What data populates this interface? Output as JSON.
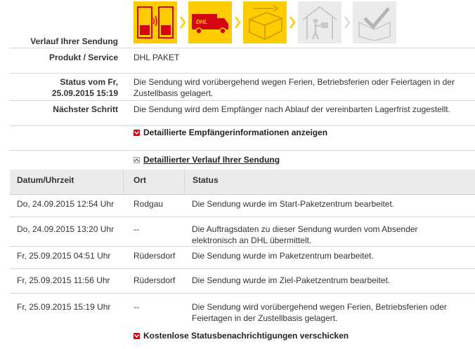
{
  "progress": {
    "label": "Verlauf Ihrer Sendung",
    "steps": [
      {
        "icon": "drop-off-icon",
        "state": "done"
      },
      {
        "icon": "truck-icon",
        "state": "done"
      },
      {
        "icon": "package-icon",
        "state": "done"
      },
      {
        "icon": "delivery-person-icon",
        "state": "pending"
      },
      {
        "icon": "delivered-check-icon",
        "state": "pending"
      }
    ],
    "colors": {
      "done": "#ffcc00",
      "pending": "#ebebeb",
      "dhl_red": "#d40511"
    }
  },
  "details": {
    "product_label": "Produkt / Service",
    "product_value": "DHL PAKET",
    "status_label_line1": "Status vom Fr,",
    "status_label_line2": "25.09.2015 15:19",
    "status_value": "Die Sendung wird vorübergehend wegen Ferien, Betriebsferien oder Feiertagen in der Zustellbasis gelagert.",
    "next_label": "Nächster Schritt",
    "next_value": "Die Sendung wird dem Empfänger nach Ablauf der vereinbarten Lagerfrist zugestellt."
  },
  "toggles": {
    "recipient_info": "Detaillierte Empfängerinformationen anzeigen",
    "history": "Detaillierter Verlauf Ihrer Sendung",
    "notifications": "Kostenlose Statusbenachrichtigungen verschicken"
  },
  "history": {
    "columns": [
      "Datum/Uhrzeit",
      "Ort",
      "Status"
    ],
    "rows": [
      {
        "date": "Do, 24.09.2015 12:54 Uhr",
        "place": "Rodgau",
        "status": "Die Sendung wurde im Start-Paketzentrum bearbeitet."
      },
      {
        "date": "Do, 24.09.2015 13:20 Uhr",
        "place": "--",
        "status": "Die Auftragsdaten zu dieser Sendung wurden vom Absender elektronisch an DHL übermittelt."
      },
      {
        "date": "Fr, 25.09.2015 04:51 Uhr",
        "place": "Rüdersdorf",
        "status": "Die Sendung wurde im Paketzentrum bearbeitet."
      },
      {
        "date": "Fr, 25.09.2015 11:56 Uhr",
        "place": "Rüdersdorf",
        "status": "Die Sendung wurde im Ziel-Paketzentrum bearbeitet."
      },
      {
        "date": "Fr, 25.09.2015 15:19 Uhr",
        "place": "--",
        "status": "Die Sendung wird vorübergehend wegen Ferien, Betriebsferien oder Feiertagen in der Zustellbasis gelagert."
      }
    ]
  }
}
